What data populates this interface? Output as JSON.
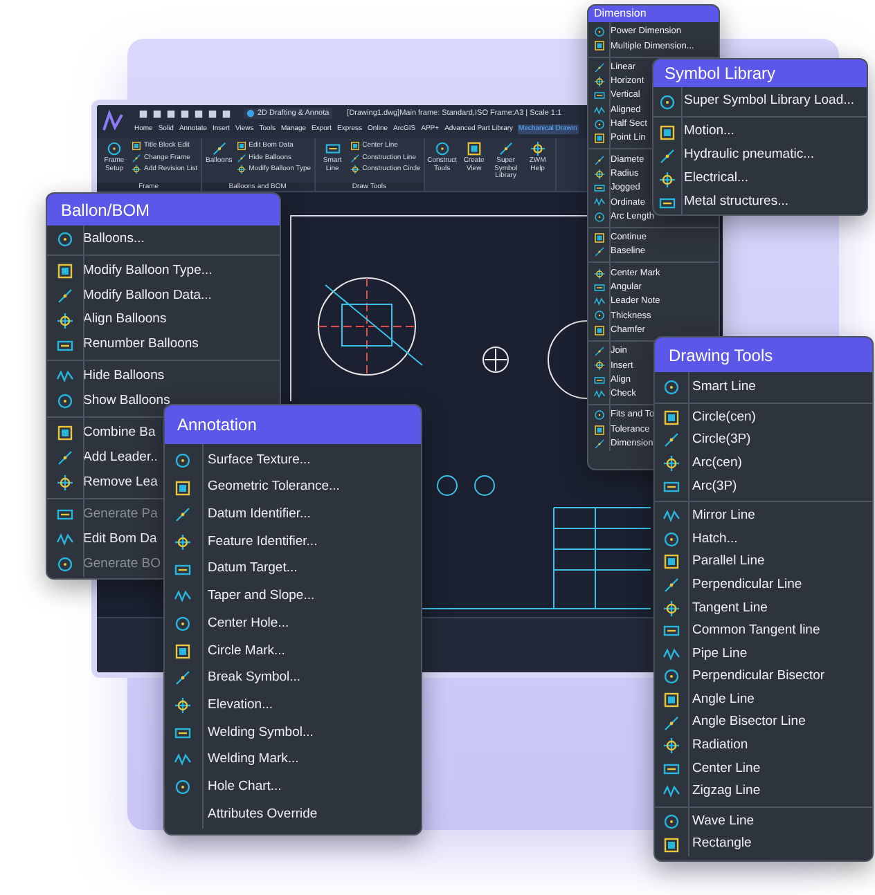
{
  "cad_window": {
    "workspace": "2D Drafting & Annota",
    "title": "[Drawing1.dwg]Main frame: Standard,ISO Frame:A3 | Scale 1:1",
    "tabs": [
      {
        "label": "Home",
        "selected": false
      },
      {
        "label": "Solid",
        "selected": false
      },
      {
        "label": "Annotate",
        "selected": false
      },
      {
        "label": "Insert",
        "selected": false
      },
      {
        "label": "Views",
        "selected": false
      },
      {
        "label": "Tools",
        "selected": false
      },
      {
        "label": "Manage",
        "selected": false
      },
      {
        "label": "Export",
        "selected": false
      },
      {
        "label": "Express",
        "selected": false
      },
      {
        "label": "Online",
        "selected": false
      },
      {
        "label": "ArcGIS",
        "selected": false
      },
      {
        "label": "APP+",
        "selected": false
      },
      {
        "label": "Advanced Part Library",
        "selected": false
      },
      {
        "label": "Mechanical Drawin",
        "selected": true
      }
    ],
    "ribbon_groups": [
      {
        "label": "Frame",
        "large": [
          "Frame Setup"
        ],
        "small": [
          "Title Block Edit",
          "Change Frame",
          "Add Revision List"
        ]
      },
      {
        "label": "Balloons and BOM",
        "large": [
          "Balloons"
        ],
        "small": [
          "Edit Bom Data",
          "Hide Balloons",
          "Modify Balloon Type"
        ]
      },
      {
        "label": "Draw Tools",
        "large": [
          "Smart Line"
        ],
        "small": [
          "Center Line",
          "Construction Line",
          "Construction Circle"
        ]
      },
      {
        "large": [
          "Construct Tools",
          "Create View",
          "Super Symbol Library",
          "ZWM Help"
        ]
      }
    ]
  },
  "dimension": {
    "title": "Dimension",
    "groups": [
      [
        "Power Dimension",
        "Multiple Dimension..."
      ],
      [
        "Linear",
        "Horizont",
        "Vertical",
        "Aligned",
        "Half Sect",
        "Point Lin"
      ],
      [
        "Diamete",
        "Radius",
        "Jogged",
        "Ordinate",
        "Arc Length"
      ],
      [
        "Continue",
        "Baseline"
      ],
      [
        "Center Mark",
        "Angular",
        "Leader Note",
        "Thickness",
        "Chamfer"
      ],
      [
        "Join",
        "Insert",
        "Align",
        "Check"
      ],
      [
        "Fits and To",
        "Tolerance",
        "Dimension"
      ]
    ]
  },
  "symbol_library": {
    "title": "Symbol Library",
    "groups": [
      [
        "Super Symbol Library Load..."
      ],
      [
        "Motion...",
        "Hydraulic pneumatic...",
        "Electrical...",
        "Metal structures..."
      ]
    ]
  },
  "ballon_bom": {
    "title": "Ballon/BOM",
    "groups": [
      [
        {
          "label": "Balloons...",
          "disabled": false
        }
      ],
      [
        {
          "label": "Modify Balloon Type...",
          "disabled": false
        },
        {
          "label": "Modify Balloon Data...",
          "disabled": false
        },
        {
          "label": "Align Balloons",
          "disabled": false
        },
        {
          "label": "Renumber Balloons",
          "disabled": false
        }
      ],
      [
        {
          "label": "Hide Balloons",
          "disabled": false
        },
        {
          "label": "Show Balloons",
          "disabled": false
        }
      ],
      [
        {
          "label": "Combine Ba",
          "disabled": false
        },
        {
          "label": "Add Leader..",
          "disabled": false
        },
        {
          "label": "Remove Lea",
          "disabled": false
        }
      ],
      [
        {
          "label": "Generate Pa",
          "disabled": true
        },
        {
          "label": "Edit Bom Da",
          "disabled": false
        },
        {
          "label": "Generate BO",
          "disabled": true
        }
      ]
    ]
  },
  "drawing_tools": {
    "title": "Drawing Tools",
    "groups": [
      [
        "Smart Line"
      ],
      [
        "Circle(cen)",
        "Circle(3P)",
        "Arc(cen)",
        "Arc(3P)"
      ],
      [
        "Mirror Line",
        "Hatch...",
        "Parallel Line",
        "Perpendicular Line",
        "Tangent Line",
        "Common Tangent line",
        "Pipe Line",
        "Perpendicular Bisector",
        "Angle Line",
        "Angle Bisector Line",
        "Radiation",
        "Center Line",
        "Zigzag Line"
      ],
      [
        "Wave Line",
        "Rectangle"
      ]
    ]
  },
  "annotation": {
    "title": "Annotation",
    "groups": [
      [
        {
          "label": "Surface Texture...",
          "icon": true
        },
        {
          "label": "Geometric Tolerance...",
          "icon": true
        },
        {
          "label": "Datum Identifier...",
          "icon": true
        },
        {
          "label": "Feature Identifier...",
          "icon": true
        },
        {
          "label": "Datum Target...",
          "icon": true
        },
        {
          "label": "Taper and Slope...",
          "icon": true
        },
        {
          "label": "Center Hole...",
          "icon": true
        },
        {
          "label": "Circle Mark...",
          "icon": true
        },
        {
          "label": "Break Symbol...",
          "icon": true
        },
        {
          "label": "Elevation...",
          "icon": true
        },
        {
          "label": "Welding Symbol...",
          "icon": true
        },
        {
          "label": "Welding Mark...",
          "icon": true
        },
        {
          "label": "Hole Chart...",
          "icon": true
        },
        {
          "label": "Attributes Override",
          "icon": false
        }
      ]
    ]
  }
}
